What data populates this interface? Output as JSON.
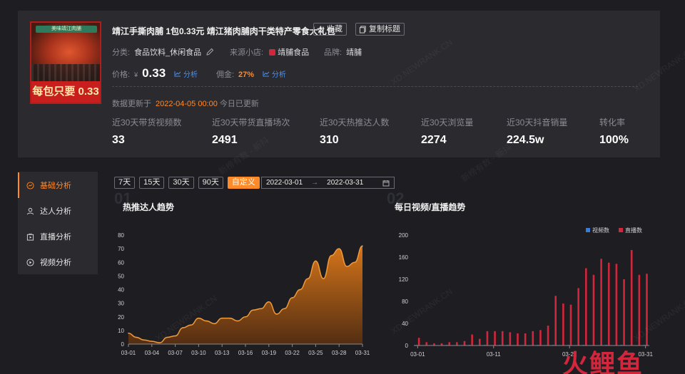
{
  "product": {
    "title": "靖江手撕肉脯 1包0.33元 靖江猪肉脯肉干类特产零食大礼包",
    "thumb_banner": "美味靖江肉脯",
    "thumb_price_text": "每包只要 0.33",
    "favorite_label": "收藏",
    "copy_title_label": "复制标题",
    "category_label": "分类:",
    "category_value": "食品饮料_休闲食品",
    "source_label": "来源小店:",
    "source_value": "靖脯食品",
    "brand_label": "品牌:",
    "brand_value": "靖脯",
    "price_label": "价格:",
    "price_symbol": "¥",
    "price_value": "0.33",
    "analyze_label": "分析",
    "commission_label": "佣金:",
    "commission_value": "27%",
    "updated_label": "数据更新于",
    "updated_time": "2022-04-05 00:00",
    "updated_note": "今日已更新"
  },
  "stats": [
    {
      "label": "近30天带货视频数",
      "value": "33"
    },
    {
      "label": "近30天带货直播场次",
      "value": "2491"
    },
    {
      "label": "近30天热推达人数",
      "value": "310"
    },
    {
      "label": "近30天浏览量",
      "value": "2274"
    },
    {
      "label": "近30天抖音销量",
      "value": "224.5w"
    },
    {
      "label": "转化率",
      "value": "100%"
    }
  ],
  "sidebar": {
    "items": [
      {
        "label": "基础分析",
        "active": true,
        "icon": "chart-circle-icon"
      },
      {
        "label": "达人分析",
        "active": false,
        "icon": "user-icon"
      },
      {
        "label": "直播分析",
        "active": false,
        "icon": "live-icon"
      },
      {
        "label": "视频分析",
        "active": false,
        "icon": "play-icon"
      }
    ]
  },
  "range_tabs": [
    {
      "label": "7天",
      "active": false
    },
    {
      "label": "15天",
      "active": false
    },
    {
      "label": "30天",
      "active": false
    },
    {
      "label": "90天",
      "active": false
    },
    {
      "label": "自定义",
      "active": true
    }
  ],
  "date_range": {
    "start": "2022-03-01",
    "arrow": "→",
    "end": "2022-03-31"
  },
  "charts": {
    "chart1_number": "01",
    "chart2_number": "02",
    "chart1_title": "热推达人趋势",
    "chart2_title": "每日视频/直播趋势"
  },
  "watermarks": [
    "XD.NEWRANK.CN",
    "新榜有数 - 新抖"
  ],
  "brand_logo": "火鲤鱼",
  "colors": {
    "accent": "#ff8a2a",
    "video": "#3a7bd5",
    "live": "#d1263b",
    "area": "#e07a1a"
  },
  "chart_data": [
    {
      "type": "area",
      "title": "热推达人趋势",
      "x": [
        "03-01",
        "03-02",
        "03-03",
        "03-04",
        "03-05",
        "03-06",
        "03-07",
        "03-08",
        "03-09",
        "03-10",
        "03-11",
        "03-12",
        "03-13",
        "03-14",
        "03-15",
        "03-16",
        "03-17",
        "03-18",
        "03-19",
        "03-20",
        "03-21",
        "03-22",
        "03-23",
        "03-24",
        "03-25",
        "03-26",
        "03-27",
        "03-28",
        "03-29",
        "03-30",
        "03-31"
      ],
      "x_ticks": [
        "03-01",
        "03-04",
        "03-07",
        "03-10",
        "03-13",
        "03-16",
        "03-19",
        "03-22",
        "03-25",
        "03-28",
        "03-31"
      ],
      "series": [
        {
          "values": [
            8,
            5,
            3,
            2,
            1,
            5,
            6,
            12,
            14,
            19,
            17,
            15,
            19,
            19,
            17,
            20,
            25,
            26,
            31,
            22,
            26,
            34,
            40,
            48,
            61,
            48,
            65,
            70,
            57,
            60,
            72
          ]
        }
      ],
      "ylim": [
        0,
        80
      ],
      "y_ticks": [
        0,
        10,
        20,
        30,
        40,
        50,
        60,
        70,
        80
      ]
    },
    {
      "type": "bar",
      "title": "每日视频/直播趋势",
      "x": [
        "03-01",
        "03-02",
        "03-03",
        "03-04",
        "03-05",
        "03-06",
        "03-07",
        "03-08",
        "03-09",
        "03-10",
        "03-11",
        "03-12",
        "03-13",
        "03-14",
        "03-15",
        "03-16",
        "03-17",
        "03-18",
        "03-19",
        "03-20",
        "03-21",
        "03-22",
        "03-23",
        "03-24",
        "03-25",
        "03-26",
        "03-27",
        "03-28",
        "03-29",
        "03-30",
        "03-31"
      ],
      "x_ticks": [
        "03-01",
        "03-11",
        "03-21",
        "03-31"
      ],
      "legend": [
        "视频数",
        "直播数"
      ],
      "legend_position": "top-right",
      "series": [
        {
          "name": "视频数",
          "values": [
            1,
            0,
            0,
            0,
            1,
            0,
            0,
            1,
            0,
            1,
            0,
            1,
            1,
            0,
            0,
            0,
            1,
            0,
            1,
            0,
            1,
            0,
            1,
            0,
            0,
            1,
            0,
            1,
            0,
            0,
            1
          ]
        },
        {
          "name": "直播数",
          "values": [
            14,
            6,
            4,
            4,
            6,
            6,
            8,
            20,
            12,
            26,
            26,
            26,
            24,
            22,
            22,
            26,
            28,
            36,
            90,
            76,
            74,
            104,
            140,
            128,
            157,
            150,
            148,
            120,
            173,
            128,
            130
          ]
        }
      ],
      "ylim": [
        0,
        200
      ],
      "y_ticks": [
        0,
        40,
        80,
        120,
        160,
        200
      ]
    }
  ]
}
